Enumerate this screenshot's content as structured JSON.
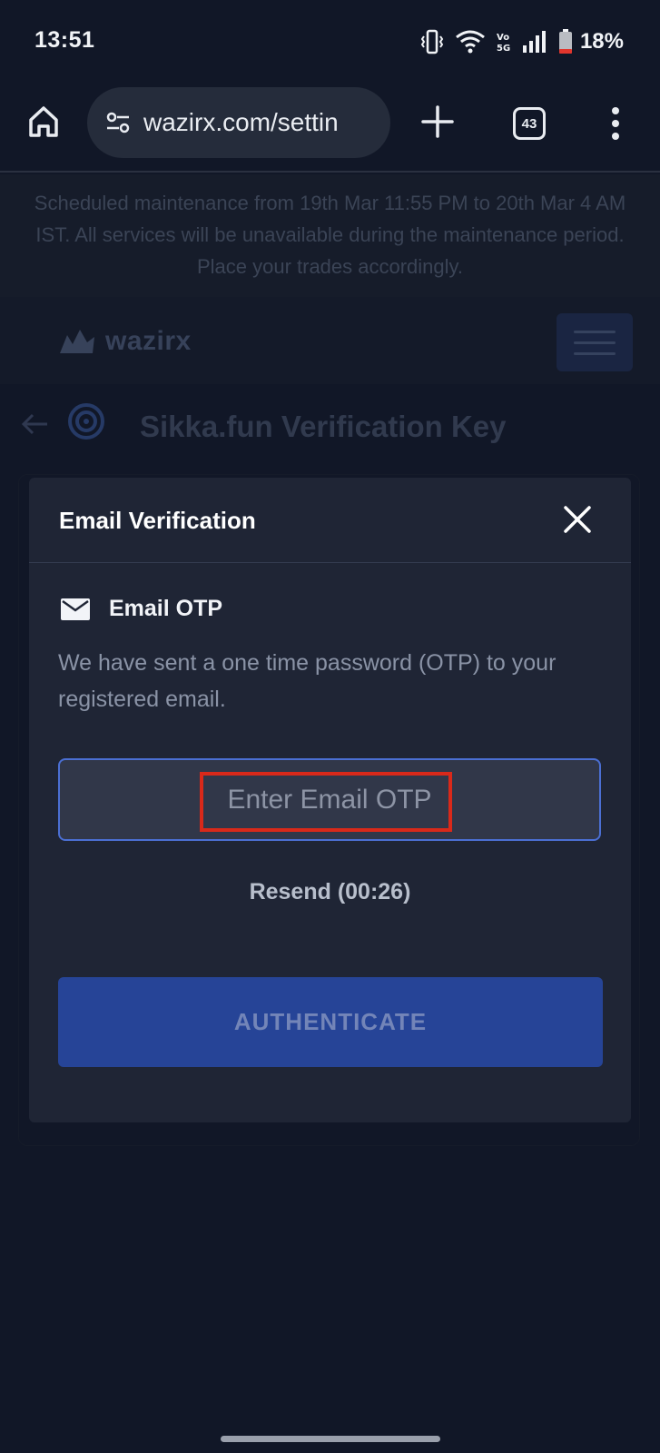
{
  "status_bar": {
    "time": "13:51",
    "battery": "18%",
    "icons": [
      "vibrate-icon",
      "wifi-icon",
      "volte-icon",
      "signal-icon",
      "battery-icon"
    ]
  },
  "browser": {
    "url": "wazirx.com/settin",
    "tab_count": "43",
    "icons": [
      "home-icon",
      "tune-icon",
      "plus-icon",
      "tabs-icon",
      "more-vert-icon"
    ]
  },
  "page": {
    "banner": "Scheduled maintenance from 19th Mar 11:55 PM to 20th Mar 4 AM IST. All services will be unavailable during the maintenance period. Place your trades accordingly.",
    "logo_text": "wazirx",
    "title": "Sikka.fun Verification Key"
  },
  "modal": {
    "title": "Email Verification",
    "otp_label": "Email OTP",
    "description": "We have sent a one time password (OTP) to your registered email.",
    "input_placeholder": "Enter Email OTP",
    "input_value": "",
    "resend_label": "Resend (00:26)",
    "button_label": "AUTHENTICATE"
  },
  "colors": {
    "background": "#111727",
    "modal_bg": "#1f2535",
    "input_border": "#4b6fd3",
    "button_bg": "#264497",
    "highlight": "#d9291a"
  }
}
